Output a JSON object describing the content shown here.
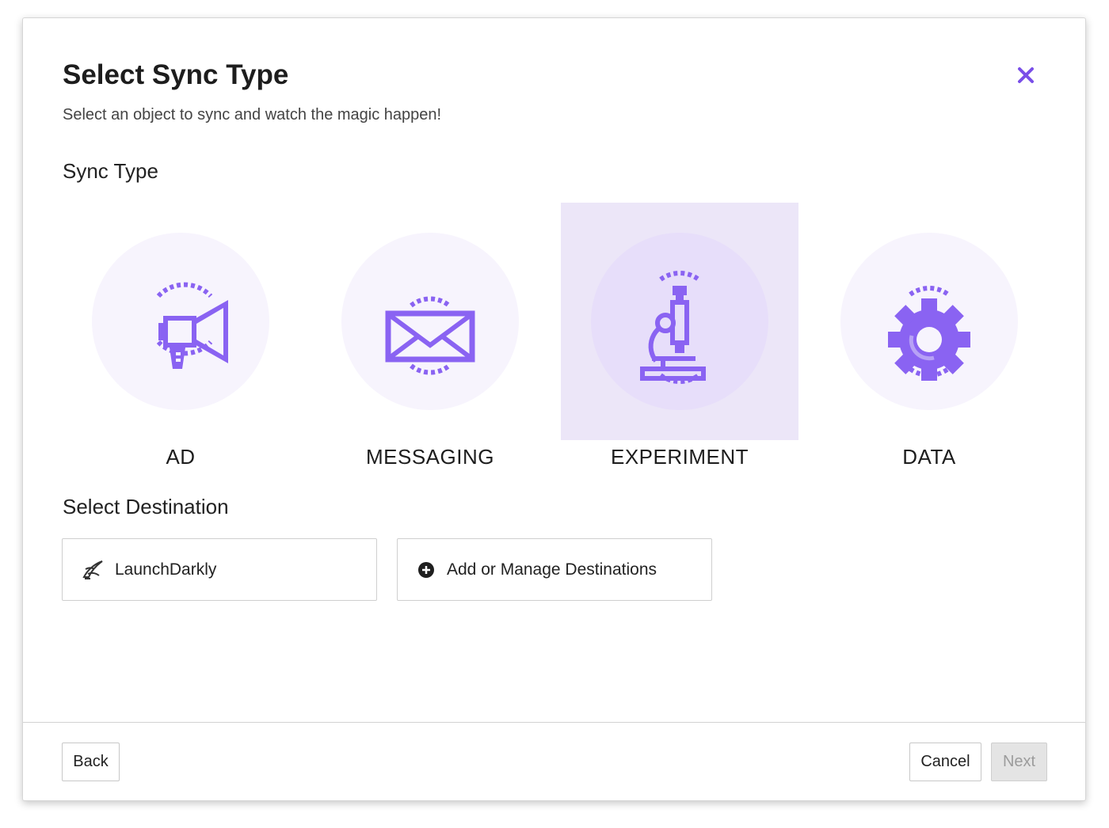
{
  "dialog": {
    "title": "Select Sync Type",
    "subtitle": "Select an object to sync and watch the magic happen!",
    "close_icon": "close-icon"
  },
  "sync_type": {
    "label": "Sync Type",
    "selected": "EXPERIMENT",
    "options": [
      {
        "label": "AD",
        "icon": "megaphone-icon"
      },
      {
        "label": "MESSAGING",
        "icon": "envelope-icon"
      },
      {
        "label": "EXPERIMENT",
        "icon": "microscope-icon"
      },
      {
        "label": "DATA",
        "icon": "gear-icon"
      }
    ]
  },
  "destination": {
    "label": "Select Destination",
    "items": [
      {
        "label": "LaunchDarkly",
        "icon": "launchdarkly-logo-icon"
      },
      {
        "label": "Add or Manage Destinations",
        "icon": "plus-circle-icon"
      }
    ]
  },
  "footer": {
    "back_label": "Back",
    "cancel_label": "Cancel",
    "next_label": "Next",
    "next_disabled": true
  },
  "colors": {
    "accent": "#8a63f2",
    "selected_tile_bg": "#ece6f8",
    "circle_bg": "#f7f4fd"
  }
}
